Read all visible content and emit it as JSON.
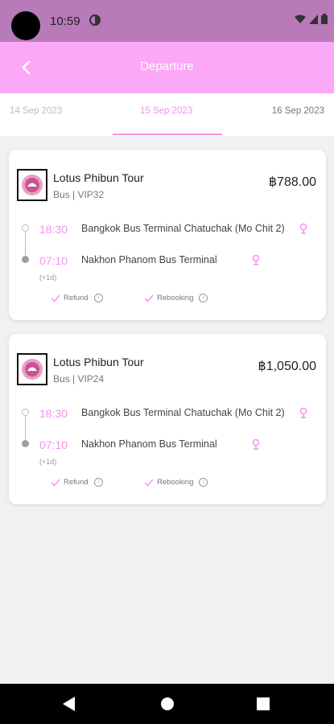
{
  "status_bar": {
    "time": "10:59"
  },
  "header": {
    "title": "Departure"
  },
  "date_tabs": [
    {
      "label": "14 Sep 2023"
    },
    {
      "label": "15 Sep 2023"
    },
    {
      "label": "16 Sep 2023"
    }
  ],
  "results": [
    {
      "operator": "Lotus Phibun Tour",
      "bus_type": "Bus | VIP32",
      "price": "฿788.00",
      "departure_time": "18:30",
      "departure_station": "Bangkok Bus Terminal Chatuchak (Mo Chit 2)",
      "arrival_time": "07:10",
      "arrival_station": "Nakhon Phanom Bus Terminal",
      "day_offset": "(+1d)",
      "refund_label": "Refund",
      "rebooking_label": "Rebooking"
    },
    {
      "operator": "Lotus Phibun Tour",
      "bus_type": "Bus | VIP24",
      "price": "฿1,050.00",
      "departure_time": "18:30",
      "departure_station": "Bangkok Bus Terminal Chatuchak (Mo Chit 2)",
      "arrival_time": "07:10",
      "arrival_station": "Nakhon Phanom Bus Terminal",
      "day_offset": "(+1d)",
      "refund_label": "Refund",
      "rebooking_label": "Rebooking"
    }
  ],
  "colors": {
    "status_bar": "#b97ab9",
    "app_bar": "#fba8f7",
    "accent": "#f690ee"
  }
}
